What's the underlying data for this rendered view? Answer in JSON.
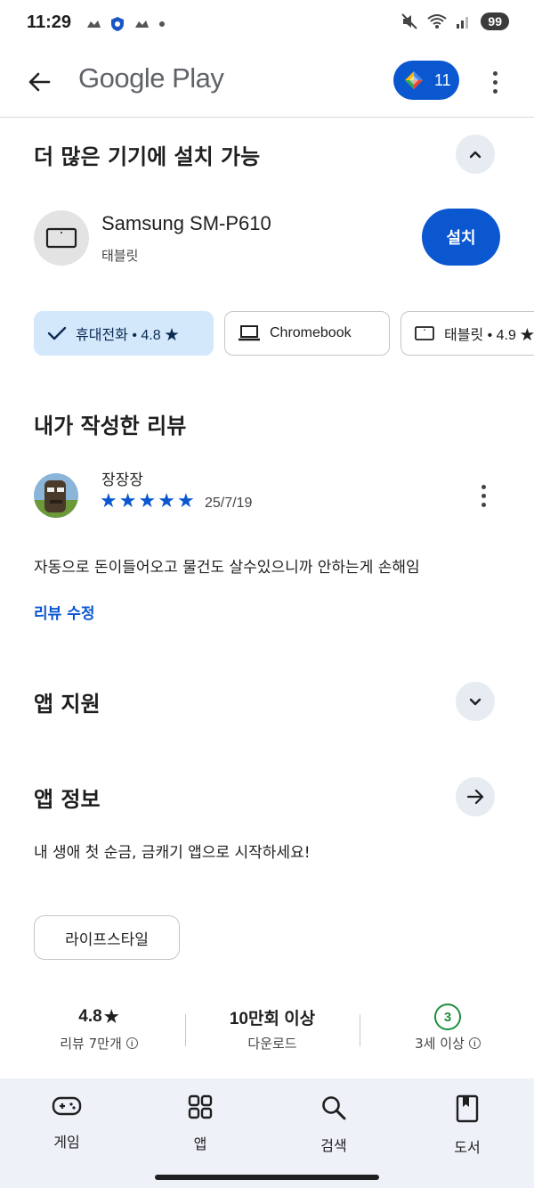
{
  "status_bar": {
    "time": "11:29",
    "battery": "99",
    "left_icons": [
      "cloud-icon",
      "shield-icon",
      "cloud-icon",
      "dot-icon"
    ],
    "right_icons": [
      "mute-icon",
      "wifi-icon",
      "signal-icon"
    ]
  },
  "app_bar": {
    "title": "Google Play",
    "points_count": "11"
  },
  "devices_section": {
    "title": "더 많은 기기에 설치 가능",
    "device_name": "Samsung SM-P610",
    "device_type": "태블릿",
    "install_label": "설치",
    "chips": [
      {
        "label": "휴대전화 • 4.8 ★",
        "icon": "check-icon",
        "selected": true
      },
      {
        "label": "Chromebook",
        "icon": "laptop-icon",
        "selected": false
      },
      {
        "label": "태블릿 • 4.9 ★",
        "icon": "tablet-icon",
        "selected": false
      }
    ]
  },
  "my_review": {
    "title": "내가 작성한 리뷰",
    "reviewer": "장장장",
    "rating": 5,
    "date": "25/7/19",
    "text": "자동으로 돈이들어오고 물건도 살수있으니까 안하는게 손해임",
    "edit_label": "리뷰 수정"
  },
  "app_support": {
    "title": "앱 지원"
  },
  "app_info": {
    "title": "앱 정보",
    "description": "내 생애 첫 순금, 금캐기 앱으로 시작하세요!",
    "category": "라이프스타일"
  },
  "stats": {
    "rating_value": "4.8",
    "rating_label": "리뷰 7만개",
    "downloads_value": "10만회 이상",
    "downloads_label": "다운로드",
    "age_value": "3",
    "age_label": "3세 이상"
  },
  "bottom_nav": {
    "items": [
      {
        "label": "게임",
        "icon": "gamepad-icon"
      },
      {
        "label": "앱",
        "icon": "apps-grid-icon"
      },
      {
        "label": "검색",
        "icon": "search-icon"
      },
      {
        "label": "도서",
        "icon": "book-icon"
      }
    ]
  },
  "colors": {
    "accent": "#0b57d0",
    "chip_selected": "#d3e8fb",
    "age_badge": "#1e8e3e",
    "nav_bg": "#eef2f8"
  }
}
